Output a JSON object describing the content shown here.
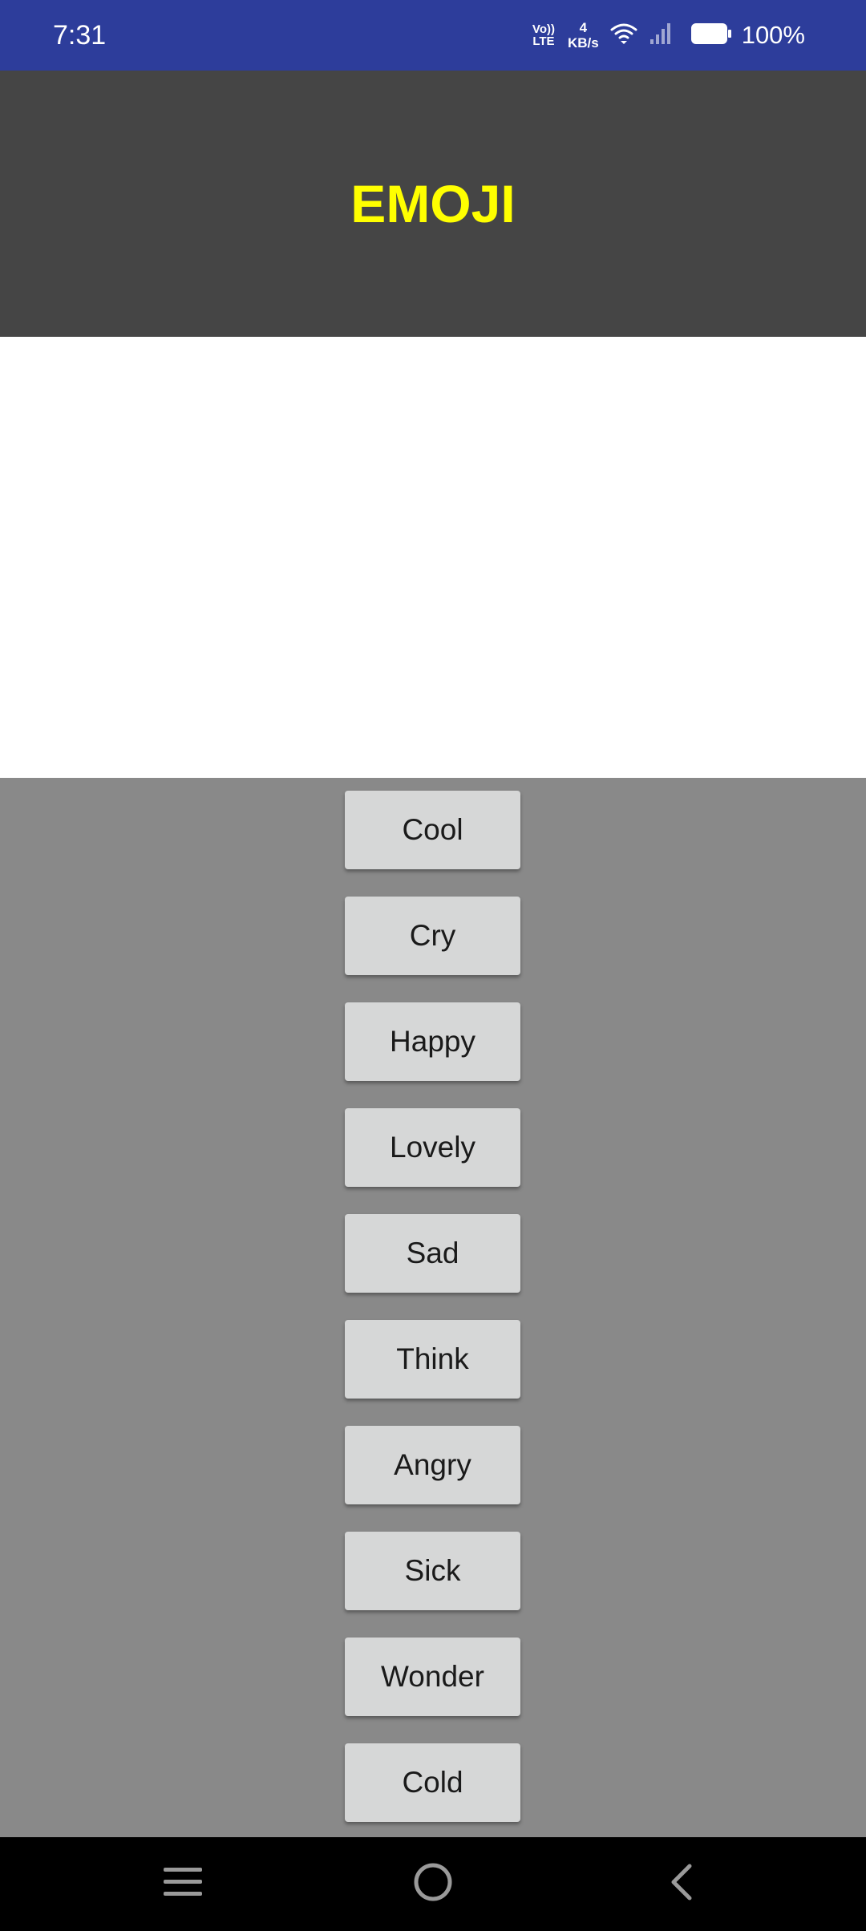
{
  "status_bar": {
    "time": "7:31",
    "volte_top": "Vo))",
    "volte_bottom": "LTE",
    "speed_value": "4",
    "speed_unit": "KB/s",
    "battery_percent": "100%",
    "icons": [
      "wifi-icon",
      "signal-icon",
      "battery-icon"
    ]
  },
  "header": {
    "title": "EMOJI",
    "title_color": "#ffff00",
    "background": "#454545"
  },
  "buttons": [
    {
      "label": "Cool"
    },
    {
      "label": "Cry"
    },
    {
      "label": "Happy"
    },
    {
      "label": "Lovely"
    },
    {
      "label": "Sad"
    },
    {
      "label": "Think"
    },
    {
      "label": "Angry"
    },
    {
      "label": "Sick"
    },
    {
      "label": "Wonder"
    },
    {
      "label": "Cold"
    }
  ],
  "nav_bar": {
    "icons": [
      "menu-icon",
      "home-icon",
      "back-icon"
    ]
  },
  "colors": {
    "status_bar": "#2d3d9b",
    "button_panel": "#898989",
    "button": "#d6d7d7"
  }
}
